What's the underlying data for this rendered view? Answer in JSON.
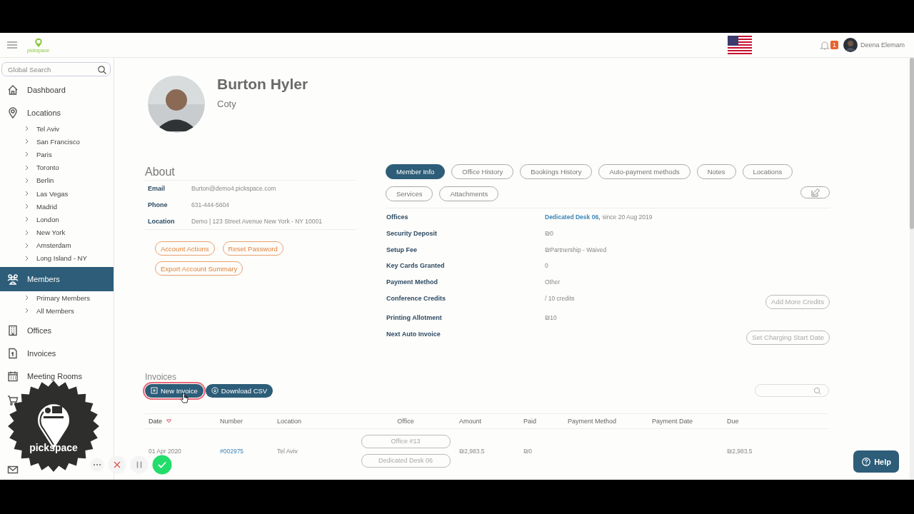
{
  "header": {
    "logo": "pickspace",
    "notifications": "1",
    "user": "Deena Elemam"
  },
  "sidebar": {
    "search_placeholder": "Global Search",
    "items": [
      {
        "label": "Dashboard",
        "kind": "home",
        "selected": false
      },
      {
        "label": "Locations",
        "kind": "pin",
        "selected": false,
        "children": [
          {
            "label": "Tel Aviv",
            "selected": false
          },
          {
            "label": "San Francisco",
            "selected": false
          },
          {
            "label": "Paris",
            "selected": false
          },
          {
            "label": "Toronto",
            "selected": false
          },
          {
            "label": "Berlin",
            "selected": false
          },
          {
            "label": "Las Vegas",
            "selected": false
          },
          {
            "label": "Madrid",
            "selected": false
          },
          {
            "label": "London",
            "selected": false
          },
          {
            "label": "New York",
            "selected": false
          },
          {
            "label": "Amsterdam",
            "selected": false
          },
          {
            "label": "Long Island - NY",
            "selected": false
          }
        ]
      },
      {
        "label": "Members",
        "kind": "people",
        "selected": true,
        "children": [
          {
            "label": "Primary Members",
            "selected": false
          },
          {
            "label": "All Members",
            "selected": false
          }
        ]
      },
      {
        "label": "Offices",
        "kind": "building",
        "selected": false
      },
      {
        "label": "Invoices",
        "kind": "invoice",
        "selected": false
      },
      {
        "label": "Meeting Rooms",
        "kind": "calendar",
        "selected": false
      },
      {
        "kind": "cart",
        "selected": false
      },
      {
        "kind": "mail",
        "selected": false
      }
    ]
  },
  "profile": {
    "name": "Burton Hyler",
    "subtitle": "Coty"
  },
  "about": {
    "title": "About",
    "fields": [
      {
        "label": "Email",
        "value": "Burton@demo4.pickspace.com"
      },
      {
        "label": "Phone",
        "value": "631-444-5604"
      },
      {
        "label": "Location",
        "value": "Demo | 123 Street Avenue New York - NY 10001"
      }
    ],
    "buttons": [
      "Account Actions",
      "Reset Password",
      "Export Account Summary"
    ]
  },
  "tabs": [
    {
      "label": "Member Info",
      "selected": true
    },
    {
      "label": "Office History",
      "selected": false
    },
    {
      "label": "Bookings History",
      "selected": false
    },
    {
      "label": "Auto-payment methods",
      "selected": false
    },
    {
      "label": "Notes",
      "selected": false
    },
    {
      "label": "Locations",
      "selected": false
    },
    {
      "label": "Services",
      "selected": false
    },
    {
      "label": "Attachments",
      "selected": false
    }
  ],
  "member_info": [
    {
      "label": "Offices",
      "link": "Dedicated Desk 06,",
      "value": "since 20 Aug 2019"
    },
    {
      "label": "Security Deposit",
      "value": "₪0"
    },
    {
      "label": "Setup Fee",
      "value": "₪Partnership - Waived"
    },
    {
      "label": "Key Cards Granted",
      "value": "0"
    },
    {
      "label": "Payment Method",
      "value": "Other"
    },
    {
      "label": "Conference Credits",
      "value": "/ 10 credits",
      "action": "Add More Credits"
    },
    {
      "label": "Printing Allotment",
      "value": "₪10"
    },
    {
      "label": "Next Auto Invoice",
      "action": "Set Charging Start Date"
    }
  ],
  "invoices": {
    "title": "Invoices",
    "buttons": [
      {
        "label": "New Invoice",
        "kind": "plus",
        "highlighted": true
      },
      {
        "label": "Download CSV",
        "kind": "download",
        "highlighted": false
      }
    ],
    "columns": [
      {
        "label": "Date",
        "sorted": true
      },
      {
        "label": "Number",
        "sorted": false
      },
      {
        "label": "Location",
        "sorted": false
      },
      {
        "label": "Office",
        "sorted": false
      },
      {
        "label": "Amount",
        "sorted": false
      },
      {
        "label": "Paid",
        "sorted": false
      },
      {
        "label": "Payment Method",
        "sorted": false
      },
      {
        "label": "Payment Date",
        "sorted": false
      },
      {
        "label": "Due",
        "sorted": false
      }
    ],
    "rows": [
      {
        "date": "01 Apr 2020",
        "number": "#002975",
        "location": "Tel Aviv",
        "offices": [
          "Office #13",
          "Dedicated Desk 06"
        ],
        "amount": "₪2,983.5",
        "paid": "₪0",
        "due": "₪2,983.5"
      }
    ]
  },
  "help": "Help",
  "badge": "pickspace"
}
